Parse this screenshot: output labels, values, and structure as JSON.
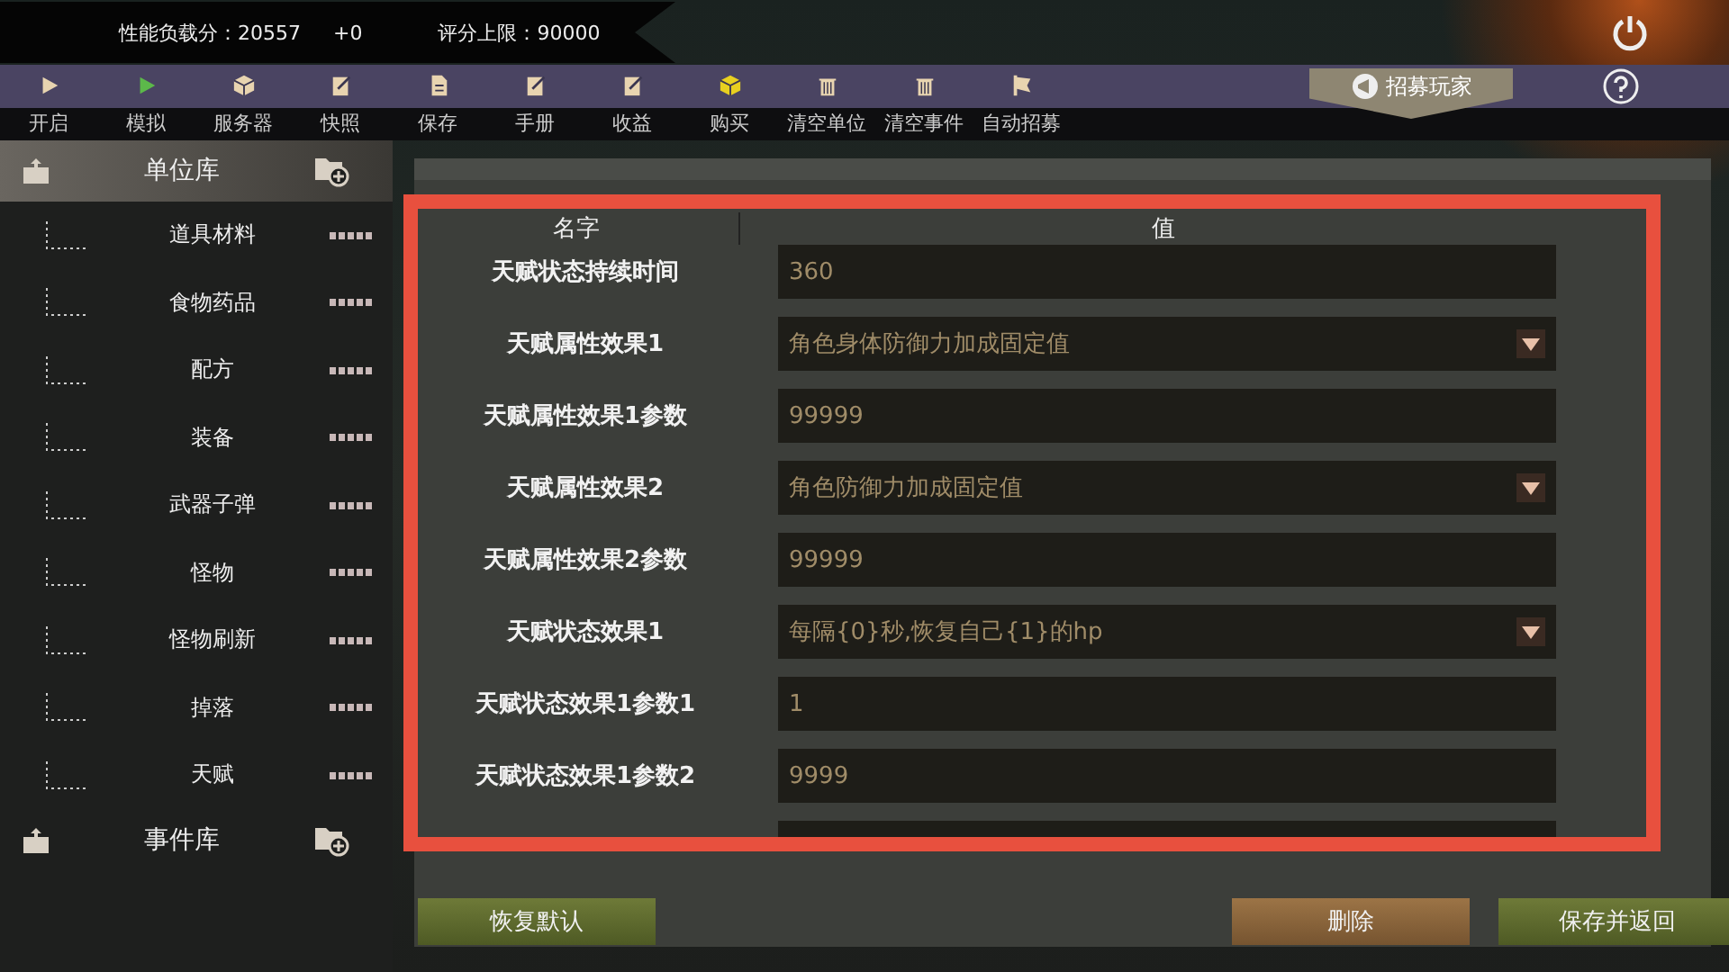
{
  "stats_bar": {
    "load_label": "性能负载分：20557",
    "delta": "+0",
    "limit_label": "评分上限：90000"
  },
  "toolbar": {
    "items": [
      {
        "label": "开启",
        "kind": "play",
        "color": "#e8d4b0"
      },
      {
        "label": "模拟",
        "kind": "play",
        "color": "#5cb84a"
      },
      {
        "label": "服务器",
        "kind": "cube",
        "color": "#e8d4b0"
      },
      {
        "label": "快照",
        "kind": "edit",
        "color": "#e8d4b0"
      },
      {
        "label": "保存",
        "kind": "doc",
        "color": "#e8d4b0"
      },
      {
        "label": "手册",
        "kind": "edit",
        "color": "#e8d4b0"
      },
      {
        "label": "收益",
        "kind": "edit",
        "color": "#e8d4b0"
      },
      {
        "label": "购买",
        "kind": "cube",
        "color": "#e8d020"
      },
      {
        "label": "清空单位",
        "kind": "trash",
        "color": "#e8d4b0"
      },
      {
        "label": "清空事件",
        "kind": "trash",
        "color": "#e8d4b0"
      },
      {
        "label": "自动招募",
        "kind": "flag",
        "color": "#e8d4b0"
      }
    ],
    "recruit_button": "招募玩家"
  },
  "sidebar": {
    "libraries": [
      {
        "label": "单位库",
        "selected": true,
        "children": [
          {
            "label": "道具材料"
          },
          {
            "label": "食物药品"
          },
          {
            "label": "配方"
          },
          {
            "label": "装备"
          },
          {
            "label": "武器子弹"
          },
          {
            "label": "怪物"
          },
          {
            "label": "怪物刷新"
          },
          {
            "label": "掉落"
          },
          {
            "label": "天赋"
          }
        ]
      },
      {
        "label": "事件库",
        "selected": false
      }
    ]
  },
  "table": {
    "columns": [
      "名字",
      "值"
    ],
    "rows": [
      {
        "name": "天赋状态持续时间",
        "kind": "text",
        "value": "360"
      },
      {
        "name": "天赋属性效果1",
        "kind": "dropdown",
        "value": "角色身体防御力加成固定值"
      },
      {
        "name": "天赋属性效果1参数",
        "kind": "text",
        "value": "99999"
      },
      {
        "name": "天赋属性效果2",
        "kind": "dropdown",
        "value": "角色防御力加成固定值"
      },
      {
        "name": "天赋属性效果2参数",
        "kind": "text",
        "value": "99999"
      },
      {
        "name": "天赋状态效果1",
        "kind": "dropdown",
        "value": "每隔{0}秒,恢复自己{1}的hp"
      },
      {
        "name": "天赋状态效果1参数1",
        "kind": "text",
        "value": "1"
      },
      {
        "name": "天赋状态效果1参数2",
        "kind": "text",
        "value": "9999"
      }
    ]
  },
  "buttons": [
    {
      "label": "恢复默认",
      "kind": "reset"
    },
    {
      "label": "删除",
      "kind": "delete"
    },
    {
      "label": "保存并返回",
      "kind": "save"
    }
  ]
}
